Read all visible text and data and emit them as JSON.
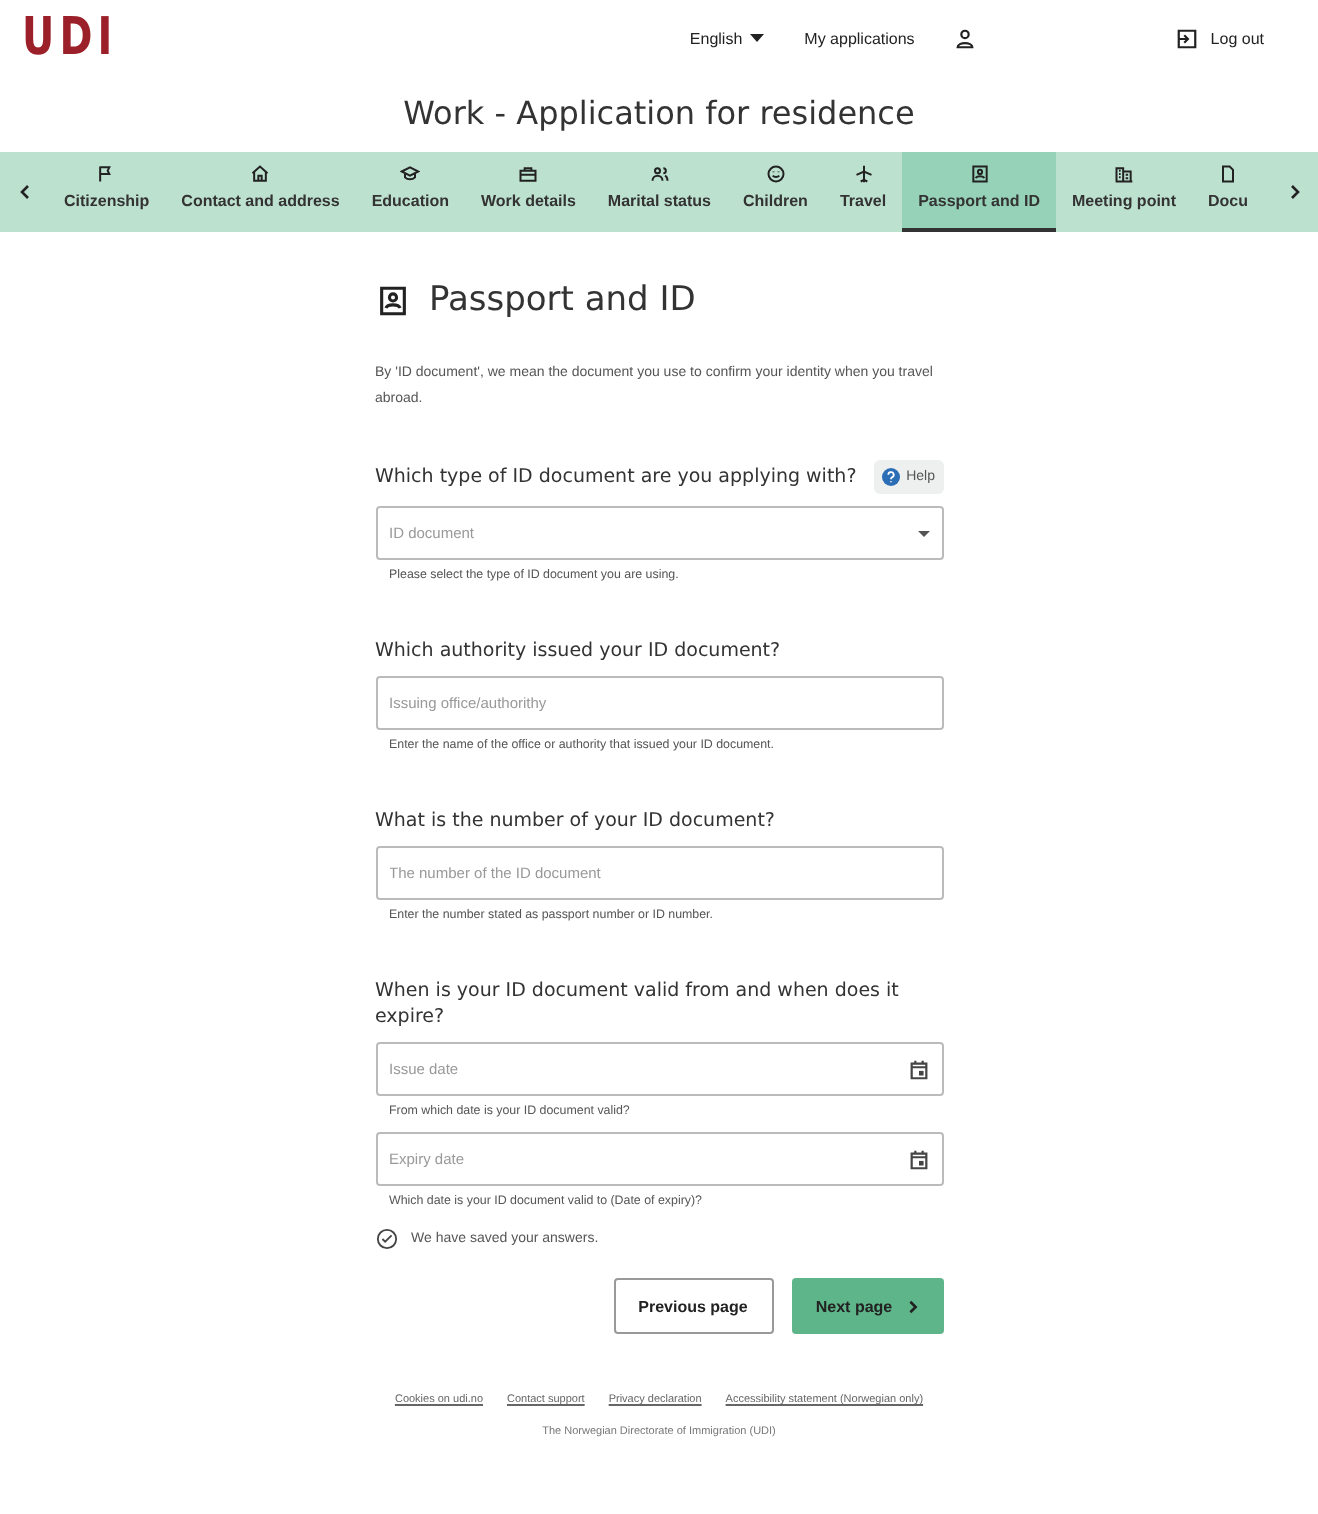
{
  "header": {
    "logo": "UDI",
    "language": "English",
    "my_applications": "My applications",
    "logout": "Log out"
  },
  "page_title": "Work - Application for residence",
  "steps": [
    {
      "label": "Citizenship",
      "selected": false
    },
    {
      "label": "Contact and address",
      "selected": false
    },
    {
      "label": "Education",
      "selected": false
    },
    {
      "label": "Work details",
      "selected": false
    },
    {
      "label": "Marital status",
      "selected": false
    },
    {
      "label": "Children",
      "selected": false
    },
    {
      "label": "Travel",
      "selected": false
    },
    {
      "label": "Passport and ID",
      "selected": true
    },
    {
      "label": "Meeting point",
      "selected": false
    },
    {
      "label": "Docu",
      "selected": false
    }
  ],
  "section": {
    "title": "Passport and ID",
    "intro": "By 'ID document', we mean the document you use to confirm your identity when you travel abroad."
  },
  "questions": [
    {
      "label": "Which type of ID document are you applying with?",
      "help": "Help",
      "fields": [
        {
          "kind": "select",
          "placeholder": "ID document",
          "hint": "Please select the type of ID document you are using."
        }
      ]
    },
    {
      "label": "Which authority issued your ID document?",
      "fields": [
        {
          "kind": "text",
          "placeholder": "Issuing office/authorithy",
          "hint": "Enter the name of the office or authority that issued your ID document."
        }
      ]
    },
    {
      "label": "What is the number of your ID document?",
      "fields": [
        {
          "kind": "text",
          "placeholder": "The number of the ID document",
          "hint": "Enter the number stated as passport number or ID number."
        }
      ]
    },
    {
      "label": "When is your ID document valid from and when does it expire?",
      "fields": [
        {
          "kind": "date",
          "placeholder": "Issue date",
          "hint": "From which date is your ID document valid?"
        },
        {
          "kind": "date",
          "placeholder": "Expiry date",
          "hint": "Which date is your ID document valid to (Date of expiry)?"
        }
      ]
    }
  ],
  "saved_note": "We have saved your answers.",
  "buttons": {
    "previous": "Previous page",
    "next": "Next page"
  },
  "footer": {
    "links": [
      "Cookies on udi.no",
      "Contact support",
      "Privacy declaration",
      "Accessibility statement (Norwegian only)"
    ],
    "org": "The Norwegian Directorate of Immigration (UDI)"
  }
}
